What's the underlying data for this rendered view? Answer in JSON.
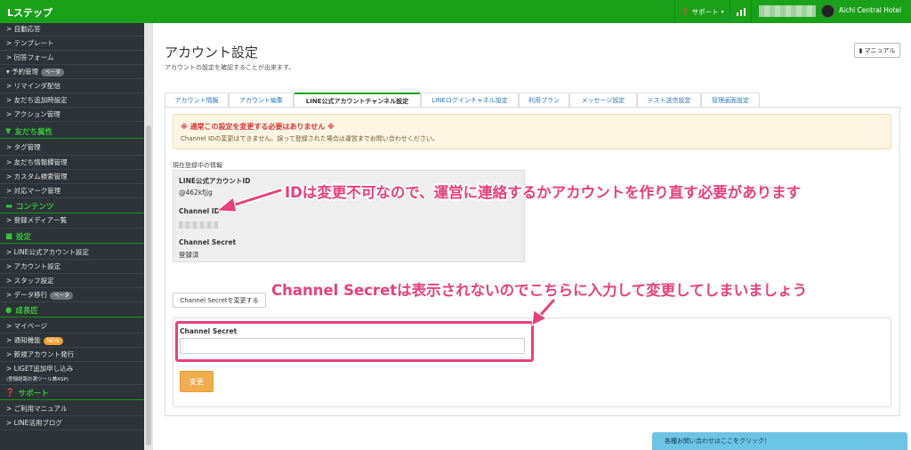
{
  "app": {
    "brand": "Lステップ"
  },
  "topbar": {
    "support": "サポート",
    "hotel_name": "Aichi Central Hotel"
  },
  "sidebar": {
    "items_top": [
      "自動応答",
      "テンプレート",
      "回答フォーム",
      "予約管理",
      "リマインダ配信",
      "友だち追加時設定",
      "アクション管理"
    ],
    "badge_beta": "ベータ",
    "badge_new": "NEW",
    "section_friends": "友だち属性",
    "items_friends": [
      "タグ管理",
      "友だち情報欄管理",
      "カスタム検索管理",
      "対応マーク管理"
    ],
    "section_contents": "コンテンツ",
    "items_contents": [
      "登録メディア一覧"
    ],
    "section_settings": "設定",
    "items_settings": [
      "LINE公式アカウント設定",
      "アカウント設定",
      "スタッフ設定",
      "データ移行"
    ],
    "section_growth": "成長匠",
    "items_growth": [
      "マイページ",
      "通知機能",
      "新規アカウント発行",
      "LIGET追加申し込み"
    ],
    "liget_sub": "(登録経路計測ツール兼ASP)",
    "section_support": "サポート",
    "items_support": [
      "ご利用マニュアル",
      "LINE活用ブログ"
    ]
  },
  "page": {
    "title": "アカウント設定",
    "subtitle": "アカウントの設定を確認することが出来ます。",
    "manual_button": "マニュアル"
  },
  "tabs": [
    "アカウント情報",
    "アカウント編集",
    "LINE公式アカウントチャンネル設定",
    "LINEログインチャネル設定",
    "利用プラン",
    "メッセージ設定",
    "テスト送信設定",
    "管理画面設定"
  ],
  "alert": {
    "title": "※ 通常この設定を変更する必要はありません ※",
    "body": "Channel IDの変更はできません。誤って登録された場合は運営までお問い合わせください。"
  },
  "current": {
    "section_label": "現在登録中の情報",
    "account_id_label": "LINE公式アカウントID",
    "account_id_value": "@462kfjjg",
    "channel_id_label": "Channel ID",
    "channel_secret_label": "Channel Secret",
    "channel_secret_value": "登録済"
  },
  "form": {
    "change_secret_button": "Channel Secretを変更する",
    "field_label": "Channel Secret",
    "field_value": "",
    "submit": "変更"
  },
  "annotations": {
    "a1": "IDは変更不可なので、運営に連絡するかアカウントを作り直す必要があります",
    "a2": "Channel Secretは表示されないのでこちらに入力して変更してしまいましょう"
  },
  "contact": "各種お問い合わせはここをクリック！",
  "colors": {
    "brand_green": "#1aa11a",
    "annotation_pink": "#e8407c",
    "alert_red": "#d9323a",
    "submit_orange": "#f0ad4e",
    "contact_blue": "#6cc3e4"
  }
}
